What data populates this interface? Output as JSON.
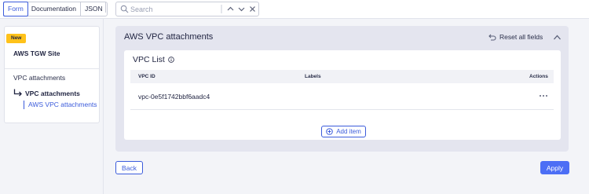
{
  "tabs": [
    {
      "label": "Form",
      "active": true
    },
    {
      "label": "Documentation",
      "active": false
    },
    {
      "label": "JSON",
      "active": false
    }
  ],
  "search": {
    "placeholder": "Search",
    "value": ""
  },
  "sidebar": {
    "badge": "New",
    "site_name": "AWS TGW Site",
    "nav_item": "VPC attachments",
    "nav_sub_item": "VPC attachments",
    "nav_leaf_item": "AWS VPC attachments"
  },
  "panel": {
    "title": "AWS VPC attachments",
    "reset_label": "Reset all fields",
    "list_title": "VPC List",
    "columns": [
      "VPC ID",
      "Labels",
      "Actions"
    ],
    "rows": [
      {
        "vpc_id": "vpc-0e5f1742bbf6aadc4",
        "labels": ""
      }
    ],
    "add_item_label": "Add item"
  },
  "footer": {
    "back_label": "Back",
    "apply_label": "Apply"
  },
  "colors": {
    "accent": "#3b5bdb",
    "apply": "#4c6ef5",
    "badge": "#ffc21a",
    "panel_bg": "#e4e5ef"
  }
}
